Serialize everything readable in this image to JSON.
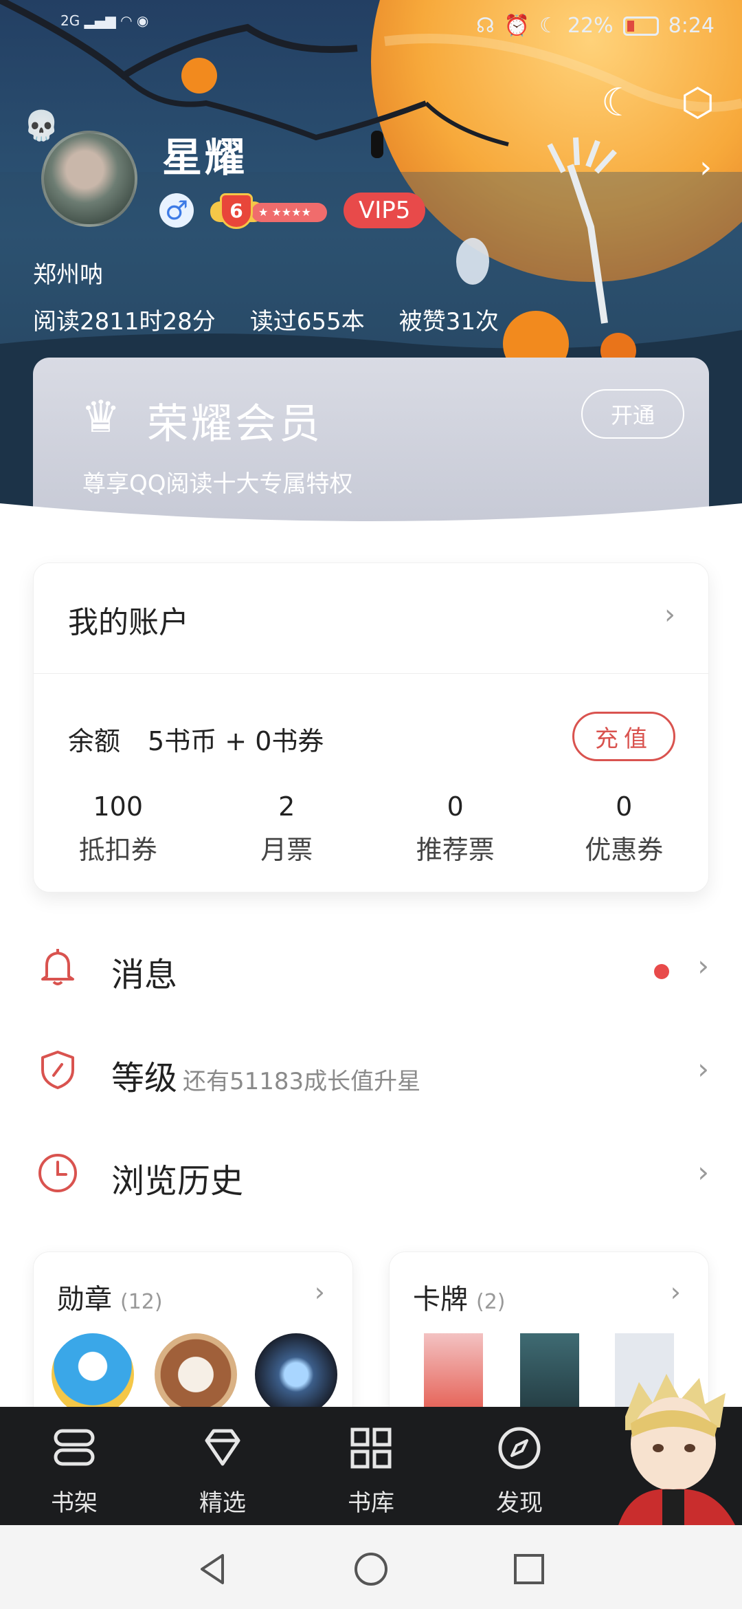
{
  "status_bar": {
    "network": "2G",
    "battery": "22%",
    "time": "8:24"
  },
  "header": {
    "night_mode_icon": "moon-icon",
    "settings_icon": "hexagon-settings-icon",
    "username": "星耀",
    "gender_symbol": "♂",
    "level": "6",
    "vip": "VIP5",
    "city": "郑州呐",
    "stats": {
      "read_time": "阅读2811时28分",
      "books_read": "读过655本",
      "likes": "被赞31次"
    }
  },
  "membership": {
    "title": "荣耀会员",
    "subtitle": "尊享QQ阅读十大专属特权",
    "open_button": "开通"
  },
  "account": {
    "title": "我的账户",
    "balance_label": "余额",
    "balance_value": "5书币 + 0书券",
    "recharge_button": "充值",
    "tickets": [
      {
        "value": "100",
        "label": "抵扣券"
      },
      {
        "value": "2",
        "label": "月票"
      },
      {
        "value": "0",
        "label": "推荐票"
      },
      {
        "value": "0",
        "label": "优惠券"
      }
    ]
  },
  "menu": {
    "messages": "消息",
    "level": "等级",
    "level_hint": "还有51183成长值升星",
    "history": "浏览历史"
  },
  "panels": {
    "medals_title": "勋章",
    "medals_count": "(12)",
    "cards_title": "卡牌",
    "cards_count": "(2)"
  },
  "bottom_nav": [
    {
      "label": "书架",
      "icon": "bookshelf-icon"
    },
    {
      "label": "精选",
      "icon": "diamond-icon"
    },
    {
      "label": "书库",
      "icon": "grid-icon"
    },
    {
      "label": "发现",
      "icon": "compass-icon"
    }
  ],
  "colors": {
    "accent_red": "#d9534f",
    "nav_bg": "#1b1c1e",
    "hero_bg": "#233f63",
    "moon": "#f7a93b"
  }
}
